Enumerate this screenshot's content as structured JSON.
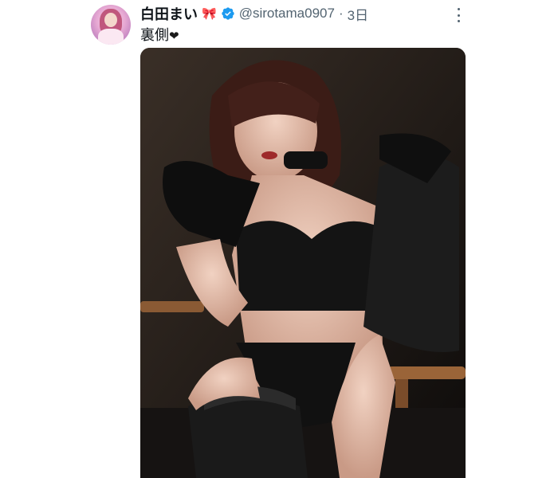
{
  "tweet": {
    "author_name": "白田まい",
    "name_emoji": "🎀",
    "verified": true,
    "handle": "@sirotama0907",
    "separator": "·",
    "time": "3日",
    "text": "裏側",
    "text_emoji": "❤",
    "more_icon": "more-vertical-icon",
    "media_description_icon": "photo"
  },
  "colors": {
    "text_primary": "#0f1419",
    "text_secondary": "#536471",
    "verified_blue": "#1d9bf0",
    "bow_red": "#e0245e"
  }
}
